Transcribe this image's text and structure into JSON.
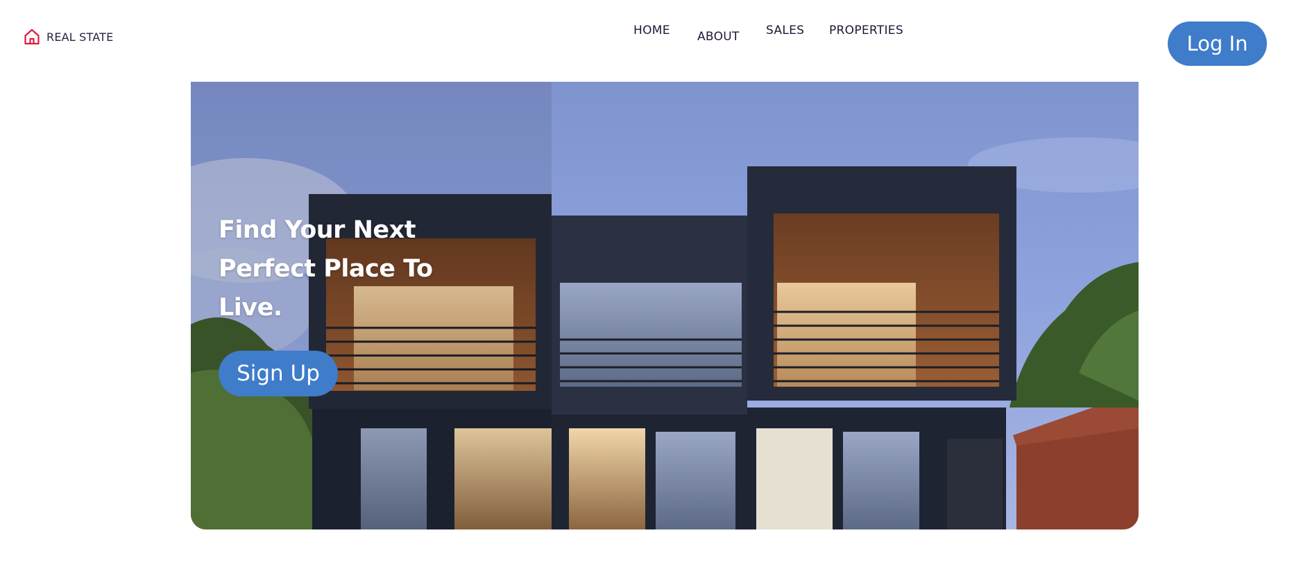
{
  "brand": {
    "name": "REAL STATE",
    "icon": "home-icon",
    "icon_color": "#e0193f"
  },
  "nav": {
    "items": [
      {
        "label": "HOME"
      },
      {
        "label": "ABOUT"
      },
      {
        "label": "SALES"
      },
      {
        "label": "PROPERTIES"
      }
    ]
  },
  "header": {
    "login_label": "Log In"
  },
  "hero": {
    "headline": "Find Your Next Perfect Place To Live.",
    "signup_label": "Sign Up",
    "image": "modern-two-storey-house-at-dusk"
  },
  "colors": {
    "accent": "#3f7cc9",
    "nav_text": "#241538",
    "brand_icon": "#e0193f"
  }
}
